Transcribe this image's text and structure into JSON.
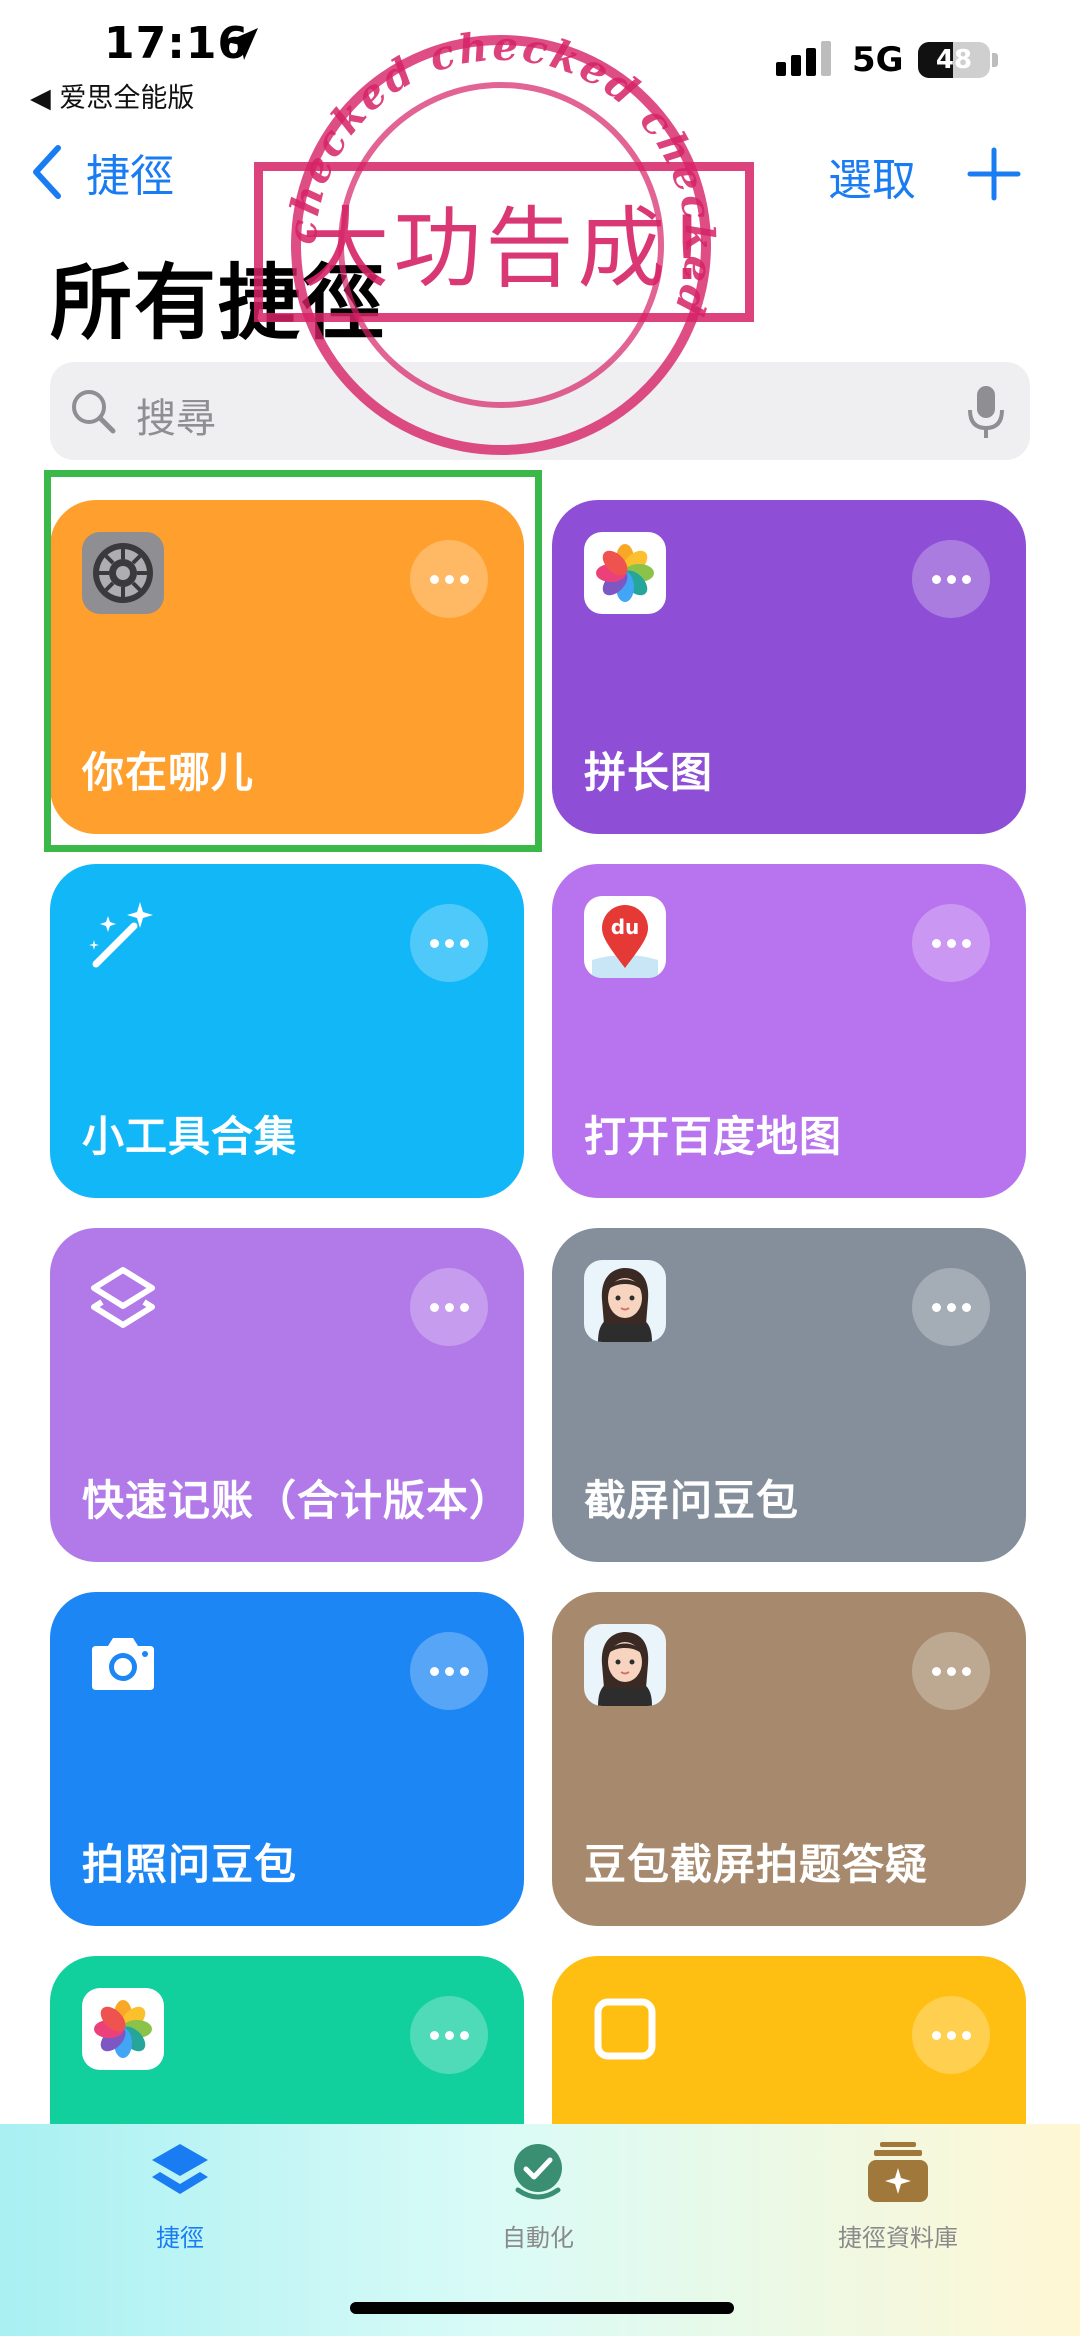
{
  "status_bar": {
    "time": "17:16",
    "back_app": "◀ 爱思全能版",
    "network": "5G",
    "battery_level": 48,
    "battery_text": "48"
  },
  "nav": {
    "back_label": "捷徑",
    "select_label": "選取"
  },
  "page_title": "所有捷徑",
  "search": {
    "placeholder": "搜尋"
  },
  "stamp": {
    "main_text": "大功告成!",
    "ring_text": "checked   checked   checked"
  },
  "tiles": [
    {
      "label": "你在哪儿",
      "icon": "settings-icon",
      "color": "#ff9f2e"
    },
    {
      "label": "拼长图",
      "icon": "photos-icon",
      "color": "#8e4fd6"
    },
    {
      "label": "小工具合集",
      "icon": "magic-wand-icon",
      "color": "#12b7f7"
    },
    {
      "label": "打开百度地图",
      "icon": "baidu-maps-icon",
      "color": "#b873ee"
    },
    {
      "label": "快速记账（合计版本）",
      "icon": "shortcuts-layers-icon",
      "color": "#b27ae8"
    },
    {
      "label": "截屏问豆包",
      "icon": "doubao-avatar-icon",
      "color": "#858f9c"
    },
    {
      "label": "拍照问豆包",
      "icon": "camera-icon",
      "color": "#1c86f5"
    },
    {
      "label": "豆包截屏拍题答疑",
      "icon": "doubao-avatar-icon",
      "color": "#a78a6d"
    },
    {
      "label": "",
      "icon": "photos-icon",
      "color": "#12cf9e"
    },
    {
      "label": "",
      "icon": "square-icon",
      "color": "#ffbe12"
    }
  ],
  "tabbar": {
    "items": [
      {
        "label": "捷徑",
        "active": true
      },
      {
        "label": "自動化",
        "active": false
      },
      {
        "label": "捷徑資料庫",
        "active": false
      }
    ]
  }
}
